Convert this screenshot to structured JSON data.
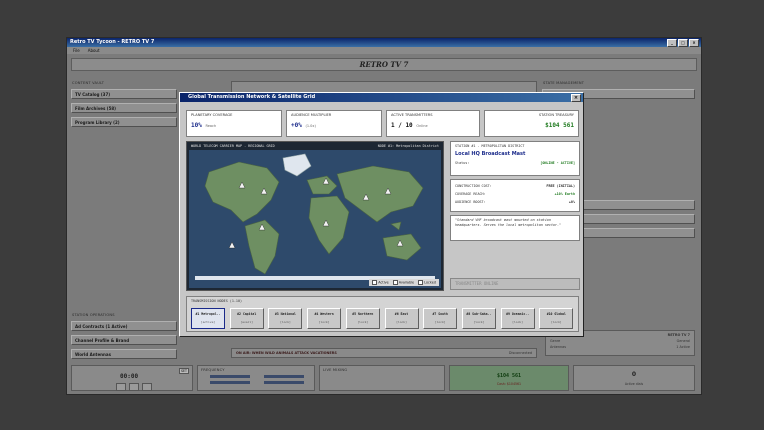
{
  "app": {
    "title": "Retro TV Tycoon - RETRO TV 7",
    "menu": [
      "File",
      "About"
    ],
    "logo": "RETRO TV 7"
  },
  "background": {
    "content_vault_label": "CONTENT VAULT",
    "vault_items": [
      "TV Catalog (37)",
      "Film Archives (58)",
      "Program Library (2)"
    ],
    "state_management_label": "STATE MANAGEMENT",
    "station_ops_label": "STATION OPERATIONS",
    "station_ops_items": [
      "Ad Contracts (1 Active)",
      "Channel Profile & Brand",
      "World Antennas"
    ],
    "ticker_text": "ON AIR: WHEN WILD ANIMALS ATTACK VACATIONERS",
    "ticker_status": "Disconnected",
    "clock": "00:00",
    "clock_badge": "SET",
    "frequency_label": "FREQUENCY",
    "live_mixing_label": "LIVE MIXING",
    "cash": "$104 561",
    "cash_sub": "Cash: $104561",
    "counter": "0",
    "counter_sub": "Active dials",
    "right_info_title": "RETRO TV 7",
    "right_info_rows": [
      [
        "Genre",
        "General"
      ],
      [
        "Antennas",
        "1 Active"
      ]
    ]
  },
  "dialog": {
    "title": "Global Transmission Network & Satellite Grid",
    "stats": [
      {
        "label": "PLANETARY COVERAGE",
        "value": "10%",
        "sub": "Reach",
        "color": "#1a2a8a"
      },
      {
        "label": "AUDIENCE MULTIPLIER",
        "value": "+0%",
        "sub": "(1.0x)",
        "color": "#1a2a8a"
      },
      {
        "label": "ACTIVE TRANSMITTERS",
        "value": "1 / 10",
        "sub": "Online",
        "color": "#111111"
      },
      {
        "label": "STATION TREASURY",
        "value": "$104 561",
        "sub": "",
        "color": "#1f7a1f"
      }
    ],
    "map": {
      "title": "WORLD TELECOM CARRIER MAP - REGIONAL GRID",
      "node_label": "NODE #1: Metropolitan District",
      "legend": [
        "Active",
        "Available",
        "Locked"
      ]
    },
    "station": {
      "header": "STATION #1 - METROPOLITAN DISTRICT",
      "name": "Local HQ Broadcast Mast",
      "status_label": "Status:",
      "status_value": "[ONLINE - ACTIVE]",
      "rows": [
        [
          "CONSTRUCTION COST:",
          "FREE (INITIAL)"
        ],
        [
          "COVERAGE REACH:",
          "+10% Earth"
        ],
        [
          "AUDIENCE BOOST:",
          "+0%"
        ]
      ],
      "description": "\"Standard VHF broadcast mast mounted on station headquarters. Serves the local metropolitan sector.\"",
      "action_button": "TRANSMITTER ONLINE"
    },
    "nodes_title": "TRANSMISSION NODES (1-10)",
    "nodes": [
      {
        "name": "#1 Metropol..",
        "state": "[active]"
      },
      {
        "name": "#2 Capital",
        "state": "[avail]"
      },
      {
        "name": "#3 National",
        "state": "[lock]"
      },
      {
        "name": "#4 Western",
        "state": "[lock]"
      },
      {
        "name": "#5 Northern",
        "state": "[lock]"
      },
      {
        "name": "#6 East",
        "state": "[lock]"
      },
      {
        "name": "#7 South",
        "state": "[lock]"
      },
      {
        "name": "#8 Sub-Saha..",
        "state": "[lock]"
      },
      {
        "name": "#9 Oceanic..",
        "state": "[lock]"
      },
      {
        "name": "#10 Global",
        "state": "[lock]"
      }
    ]
  }
}
